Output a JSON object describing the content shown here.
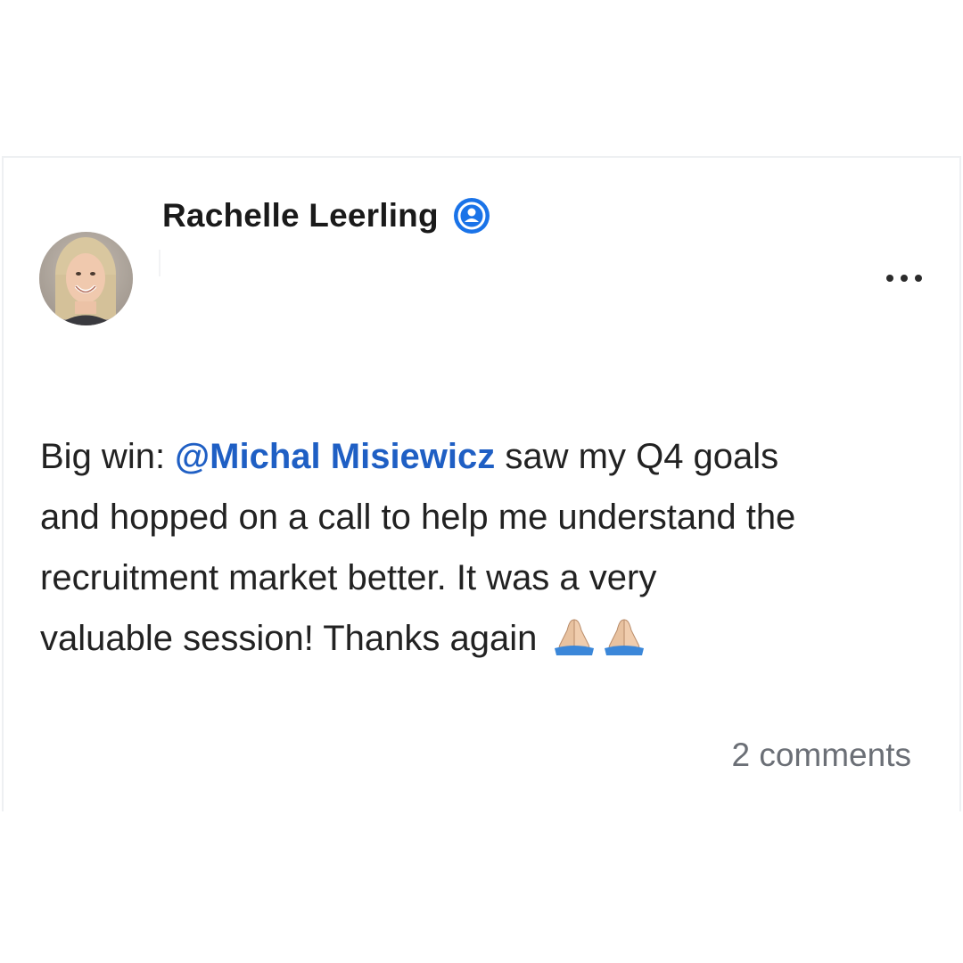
{
  "post": {
    "author_name": "Rachelle Leerling",
    "body": {
      "prefix": "Big win: ",
      "mention": "@Michal Misiewicz",
      "line1_rest": " saw my Q4 goals",
      "line2": "and hopped on a call to help me understand the",
      "line3": "recruitment market better. It was a very",
      "line4": "valuable session!  Thanks again "
    },
    "comments_count": "2 comments"
  },
  "icons": {
    "verified": "person-badge-icon",
    "more": "more-horizontal-icon",
    "emoji": "folded-hands-emoji"
  },
  "colors": {
    "mention": "#1f5fc4",
    "verified_badge": "#1a73e8",
    "comments_text": "#6b6f76"
  }
}
